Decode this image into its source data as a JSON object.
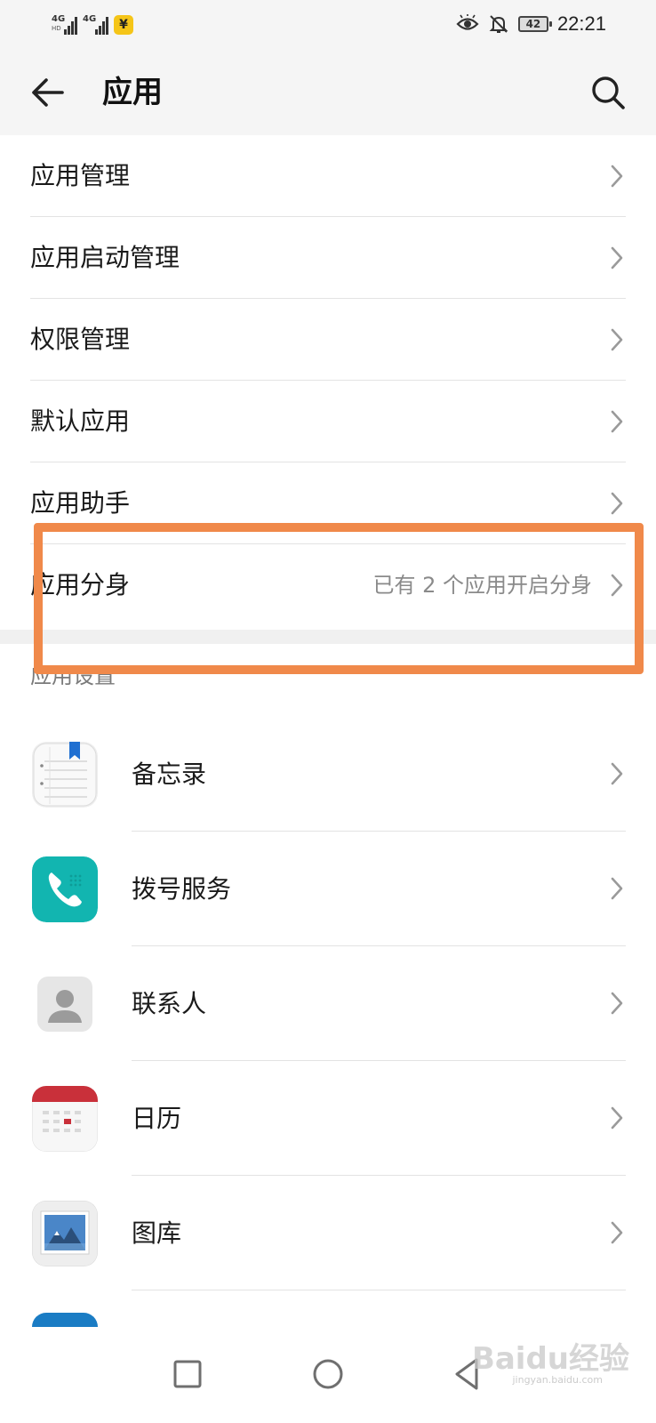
{
  "status_bar": {
    "signal_1": "4G",
    "signal_2": "4G",
    "battery": "42",
    "time": "22:21",
    "icons": [
      "signal-4g-icon",
      "signal-4g-icon",
      "wallet-yen-icon",
      "eye-comfort-icon",
      "bell-off-icon",
      "battery-icon"
    ]
  },
  "header": {
    "title": "应用"
  },
  "menu": {
    "items": [
      {
        "label": "应用管理",
        "value": ""
      },
      {
        "label": "应用启动管理",
        "value": ""
      },
      {
        "label": "权限管理",
        "value": ""
      },
      {
        "label": "默认应用",
        "value": ""
      },
      {
        "label": "应用助手",
        "value": ""
      },
      {
        "label": "应用分身",
        "value": "已有 2 个应用开启分身"
      }
    ]
  },
  "app_settings": {
    "section_title": "应用设置",
    "items": [
      {
        "label": "备忘录",
        "icon": "notepad-icon"
      },
      {
        "label": "拨号服务",
        "icon": "phone-icon"
      },
      {
        "label": "联系人",
        "icon": "contacts-icon"
      },
      {
        "label": "日历",
        "icon": "calendar-icon"
      },
      {
        "label": "图库",
        "icon": "gallery-icon"
      }
    ]
  },
  "watermark": {
    "text": "Baidu经验",
    "sub": "jingyan.baidu.com"
  },
  "colors": {
    "highlight": "#f0894a",
    "header_bg": "#f5f5f5",
    "secondary_text": "#8a8a8a"
  }
}
